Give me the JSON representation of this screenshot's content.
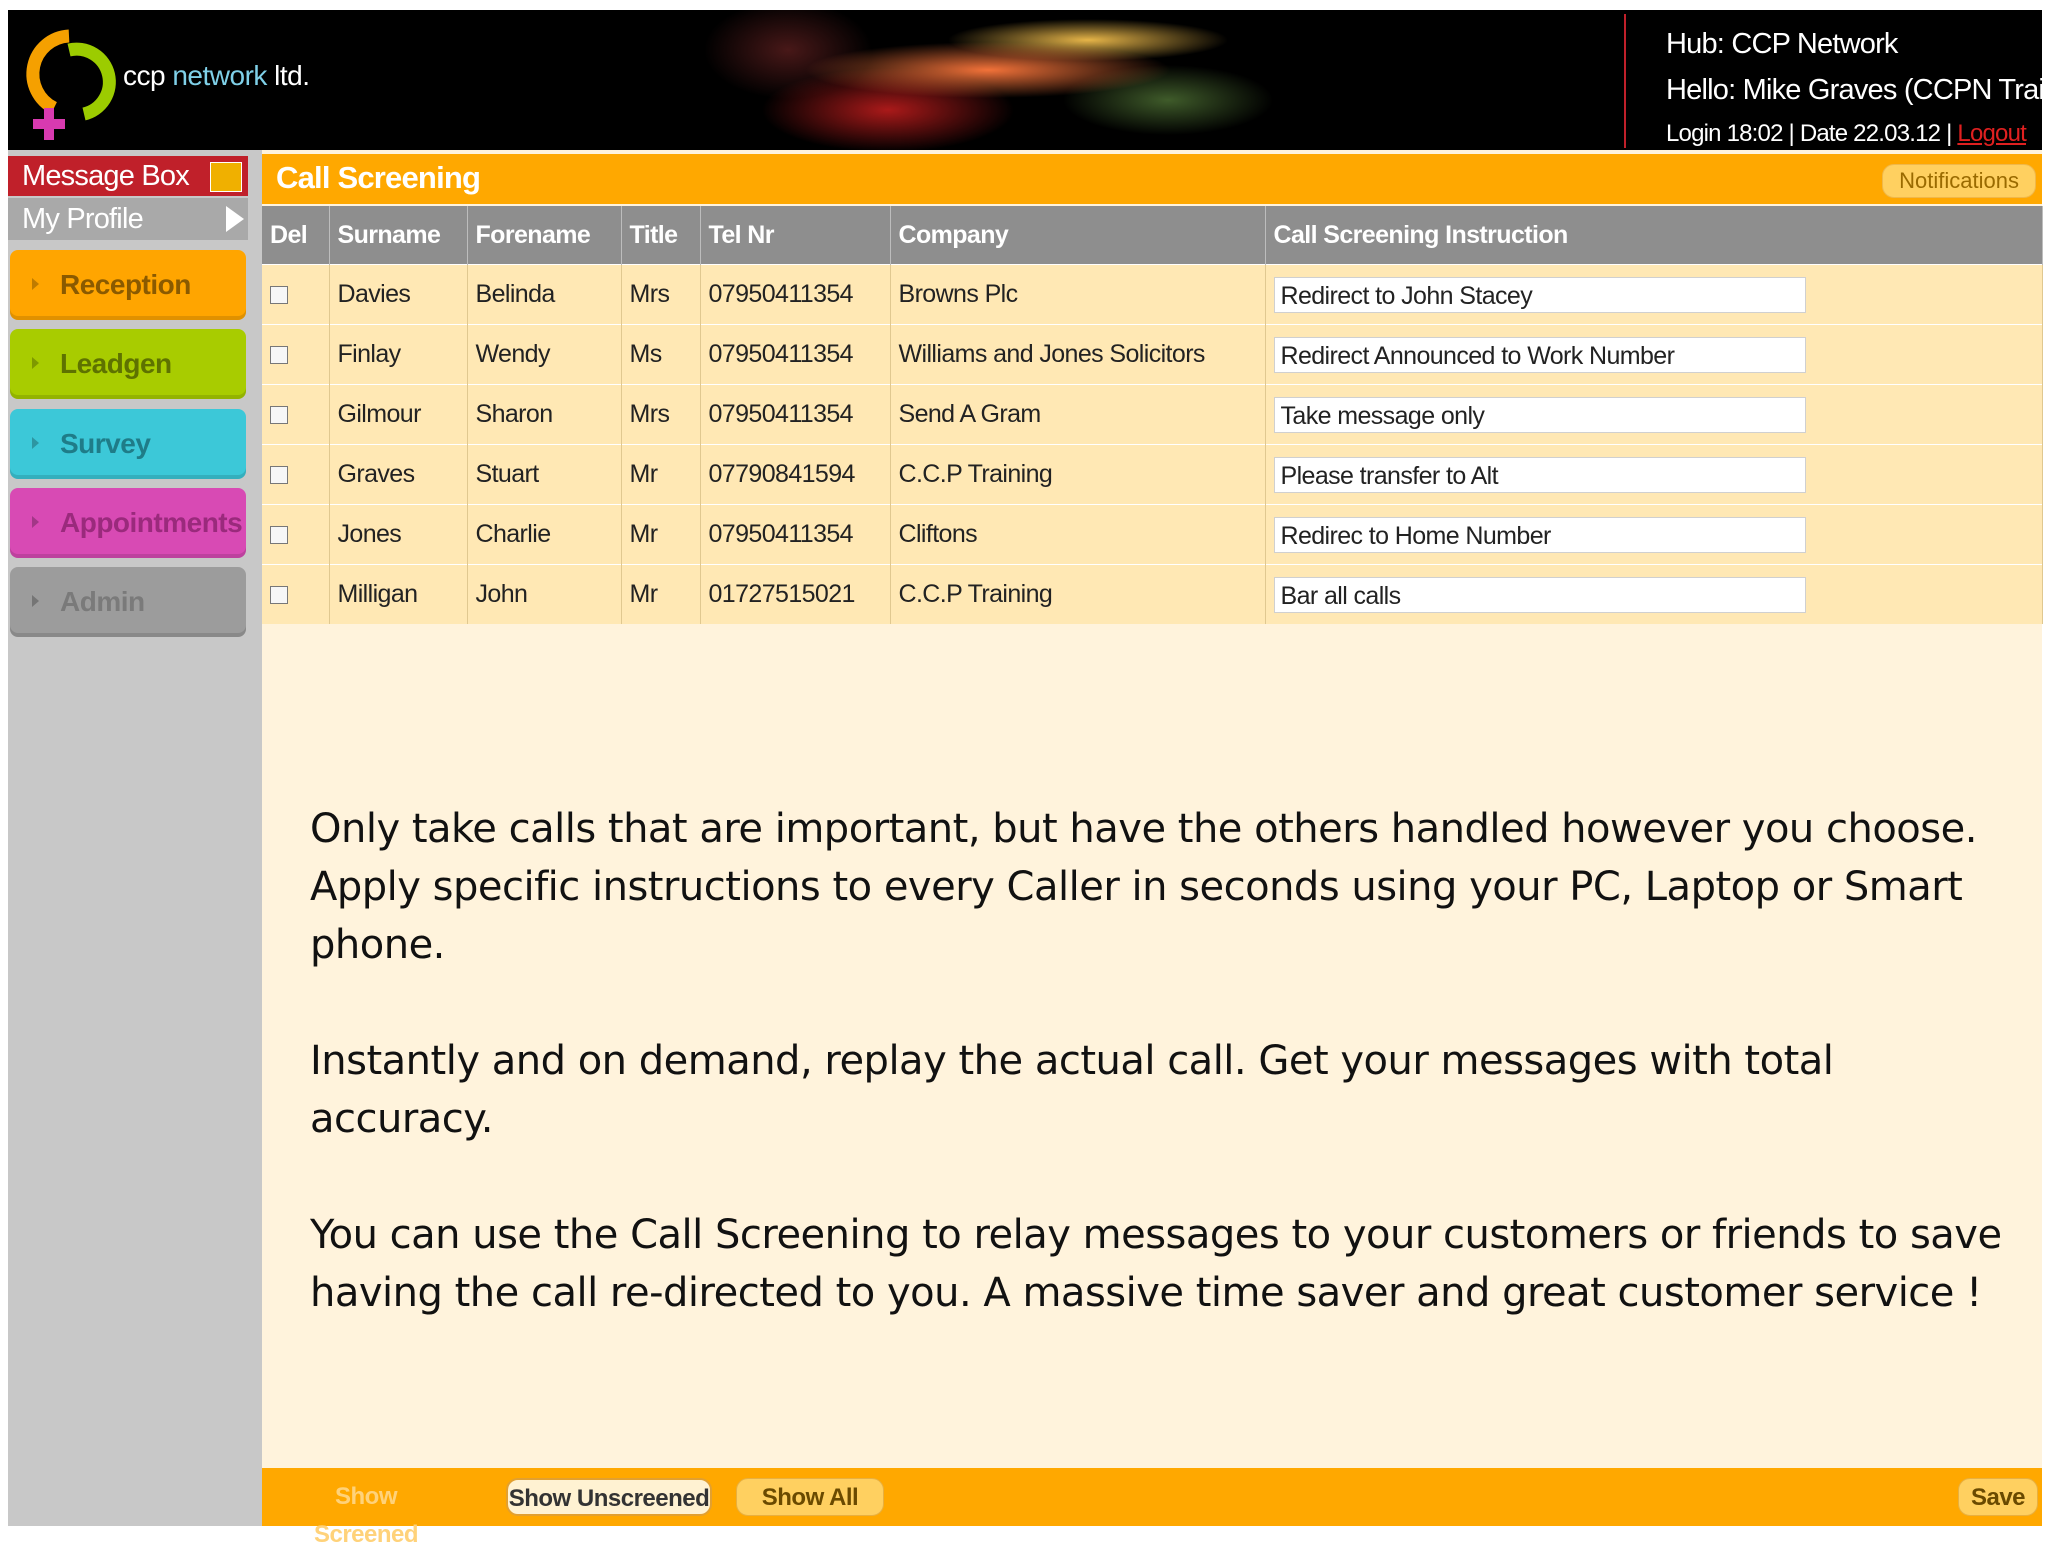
{
  "header": {
    "logo_text_ccp": "ccp ",
    "logo_text_network": "network",
    "logo_text_ltd": " ltd.",
    "hub": "Hub: CCP Network",
    "hello": "Hello: Mike Graves (CCPN Training)",
    "login_info": "Login 18:02 | Date 22.03.12 | ",
    "logout": "Logout"
  },
  "sidebar": {
    "message_box": "Message Box",
    "my_profile": "My Profile",
    "nav": [
      "Reception",
      "Leadgen",
      "Survey",
      "Appointments",
      "Admin"
    ]
  },
  "main": {
    "title": "Call Screening",
    "notifications": "Notifications"
  },
  "table": {
    "headers": [
      "Del",
      "Surname",
      "Forename",
      "Title",
      "Tel Nr",
      "Company",
      "Call Screening Instruction"
    ],
    "rows": [
      {
        "surname": "Davies",
        "forename": "Belinda",
        "title": "Mrs",
        "tel": "07950411354",
        "company": "Browns Plc",
        "instruction": "Redirect to John Stacey"
      },
      {
        "surname": "Finlay",
        "forename": "Wendy",
        "title": "Ms",
        "tel": "07950411354",
        "company": "Williams and Jones Solicitors",
        "instruction": "Redirect Announced to Work Number"
      },
      {
        "surname": "Gilmour",
        "forename": "Sharon",
        "title": "Mrs",
        "tel": "07950411354",
        "company": "Send A Gram",
        "instruction": "Take message only"
      },
      {
        "surname": "Graves",
        "forename": "Stuart",
        "title": "Mr",
        "tel": "07790841594",
        "company": "C.C.P Training",
        "instruction": "Please transfer to Alt"
      },
      {
        "surname": "Jones",
        "forename": "Charlie",
        "title": "Mr",
        "tel": "07950411354",
        "company": "Cliftons",
        "instruction": "Redirec to Home Number"
      },
      {
        "surname": "Milligan",
        "forename": "John",
        "title": "Mr",
        "tel": "01727515021",
        "company": "C.C.P Training",
        "instruction": "Bar all calls"
      }
    ]
  },
  "body_text": {
    "p1": "Only take calls that are important, but have the others handled however you choose.",
    "p2": "Apply specific instructions to every Caller in seconds using your PC, Laptop or Smart phone.",
    "p3": "Instantly and on demand, replay the actual call. Get your messages with total accuracy.",
    "p4": "You can use the Call Screening to relay messages to your customers or friends to save having the call re-directed  to you.  A massive time saver and great customer service !"
  },
  "footer": {
    "show_screened": "Show Screened",
    "show_unscreened": "Show Unscreened",
    "show_all": "Show All",
    "save": "Save"
  },
  "colors": {
    "accent_orange": "#ffa800",
    "logout_red": "#e02020",
    "nav_reception": "#ffa500",
    "nav_leadgen": "#a8cc00",
    "nav_survey": "#3cc8d8",
    "nav_appointments": "#d84ab4",
    "nav_admin": "#9c9c9c"
  }
}
